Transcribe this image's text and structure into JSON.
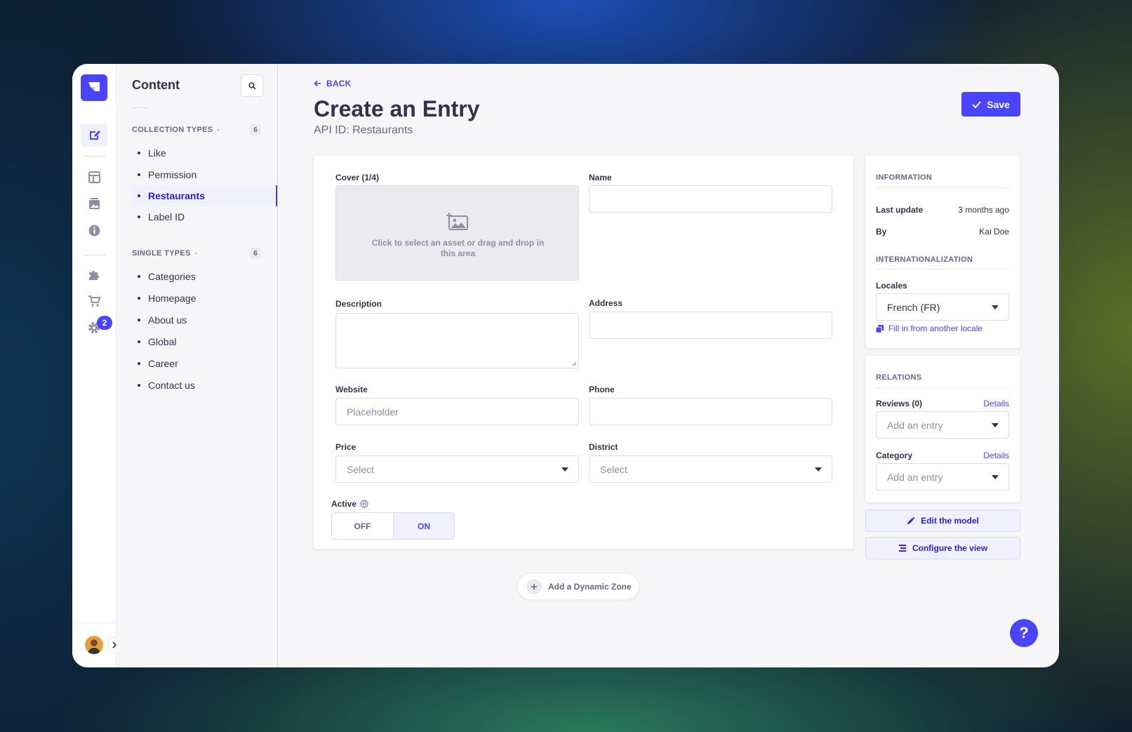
{
  "colors": {
    "primary": "#4945ff",
    "primary_light": "#f0f0ff",
    "text": "#32324d",
    "muted": "#666687",
    "bg": "#f6f6f9"
  },
  "mainnav": {
    "icons": [
      "content-manager-icon",
      "layout-icon",
      "media-library-icon",
      "info-icon",
      "plugins-icon",
      "marketplace-icon",
      "settings-icon"
    ],
    "settings_badge": "2"
  },
  "subnav": {
    "title": "Content",
    "collection_types": {
      "label": "COLLECTION TYPES",
      "count": "6",
      "items": [
        "Like",
        "Permission",
        "Restaurants",
        "Label ID"
      ],
      "active": "Restaurants"
    },
    "single_types": {
      "label": "SINGLE TYPES",
      "count": "6",
      "items": [
        "Categories",
        "Homepage",
        "About us",
        "Global",
        "Career",
        "Contact us"
      ]
    }
  },
  "header": {
    "back": "BACK",
    "title": "Create an Entry",
    "subtitle": "API ID: Restaurants",
    "save": "Save"
  },
  "form": {
    "cover_label": "Cover (1/4)",
    "cover_text": "Click to select an asset or drag and drop in this area",
    "name_label": "Name",
    "description_label": "Description",
    "address_label": "Address",
    "website_label": "Website",
    "website_placeholder": "Placeholder",
    "phone_label": "Phone",
    "price_label": "Price",
    "price_value": "Select",
    "district_label": "District",
    "district_value": "Select",
    "active_label": "Active",
    "toggle_off": "OFF",
    "toggle_on": "ON",
    "toggle_state": "ON"
  },
  "dynamic_zone": "Add a Dynamic Zone",
  "information": {
    "heading": "INFORMATION",
    "last_update_label": "Last update",
    "last_update_value": "3 months ago",
    "by_label": "By",
    "by_value": "Kai Doe",
    "i18n_heading": "INTERNATIONALIZATION",
    "locales_label": "Locales",
    "locale_value": "French (FR)",
    "fill_in": "Fill in from another locale"
  },
  "relations": {
    "heading": "RELATIONS",
    "reviews_label": "Reviews (0)",
    "reviews_details": "Details",
    "reviews_placeholder": "Add an entry",
    "category_label": "Category",
    "category_details": "Details",
    "category_placeholder": "Add an entry"
  },
  "actions": {
    "edit_model": "Edit the model",
    "configure_view": "Configure the view"
  },
  "help": "?"
}
